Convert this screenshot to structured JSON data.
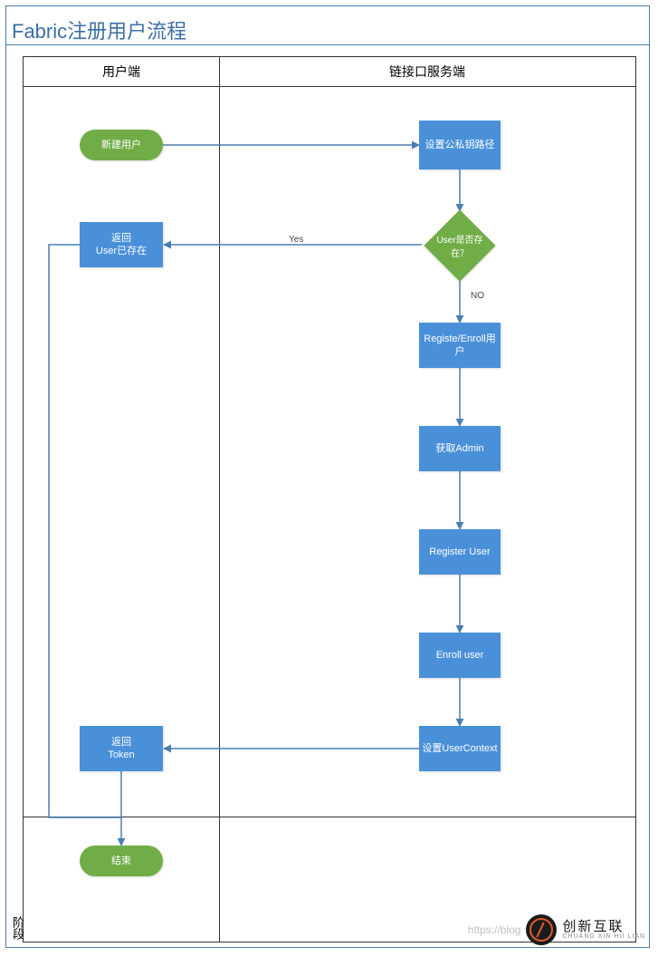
{
  "title": "Fabric注册用户流程",
  "lanes": {
    "client": "用户端",
    "server": "链接口服务端"
  },
  "nodes": {
    "start": "新建用户",
    "setKeyPath": "设置公私钥路径",
    "decision": "User是否存在？",
    "userExists": {
      "l1": "返回",
      "l2": "User已存在"
    },
    "enroll": "Registe/Enroll用户",
    "getAdmin": "获取Admin",
    "registerUser": "Register User",
    "enrollUser": "Enroll user",
    "setContext": "设置UserContext",
    "returnToken": {
      "l1": "返回",
      "l2": "Token"
    },
    "end": "结束"
  },
  "edges": {
    "yes": "Yes",
    "no": "NO"
  },
  "phase": "阶段",
  "watermark": {
    "url": "https://blog",
    "brand": "创新互联",
    "brand_py": "CHUANG XIN HU LIAN"
  },
  "chart_data": {
    "type": "flowchart",
    "title": "Fabric注册用户流程",
    "swimlanes": [
      "用户端",
      "链接口服务端"
    ],
    "nodes": [
      {
        "id": "start",
        "lane": "用户端",
        "type": "terminator",
        "label": "新建用户"
      },
      {
        "id": "setKeyPath",
        "lane": "链接口服务端",
        "type": "process",
        "label": "设置公私钥路径"
      },
      {
        "id": "decision",
        "lane": "链接口服务端",
        "type": "decision",
        "label": "User是否存在？"
      },
      {
        "id": "userExists",
        "lane": "用户端",
        "type": "process",
        "label": "返回 User已存在"
      },
      {
        "id": "enroll",
        "lane": "链接口服务端",
        "type": "process",
        "label": "Registe/Enroll用户"
      },
      {
        "id": "getAdmin",
        "lane": "链接口服务端",
        "type": "process",
        "label": "获取Admin"
      },
      {
        "id": "registerUser",
        "lane": "链接口服务端",
        "type": "process",
        "label": "Register User"
      },
      {
        "id": "enrollUser",
        "lane": "链接口服务端",
        "type": "process",
        "label": "Enroll user"
      },
      {
        "id": "setContext",
        "lane": "链接口服务端",
        "type": "process",
        "label": "设置UserContext"
      },
      {
        "id": "returnToken",
        "lane": "用户端",
        "type": "process",
        "label": "返回 Token"
      },
      {
        "id": "end",
        "lane": "用户端",
        "type": "terminator",
        "label": "结束"
      }
    ],
    "edges": [
      {
        "from": "start",
        "to": "setKeyPath"
      },
      {
        "from": "setKeyPath",
        "to": "decision"
      },
      {
        "from": "decision",
        "to": "userExists",
        "label": "Yes"
      },
      {
        "from": "decision",
        "to": "enroll",
        "label": "NO"
      },
      {
        "from": "enroll",
        "to": "getAdmin"
      },
      {
        "from": "getAdmin",
        "to": "registerUser"
      },
      {
        "from": "registerUser",
        "to": "enrollUser"
      },
      {
        "from": "enrollUser",
        "to": "setContext"
      },
      {
        "from": "setContext",
        "to": "returnToken"
      },
      {
        "from": "returnToken",
        "to": "end"
      },
      {
        "from": "userExists",
        "to": "end"
      }
    ]
  }
}
